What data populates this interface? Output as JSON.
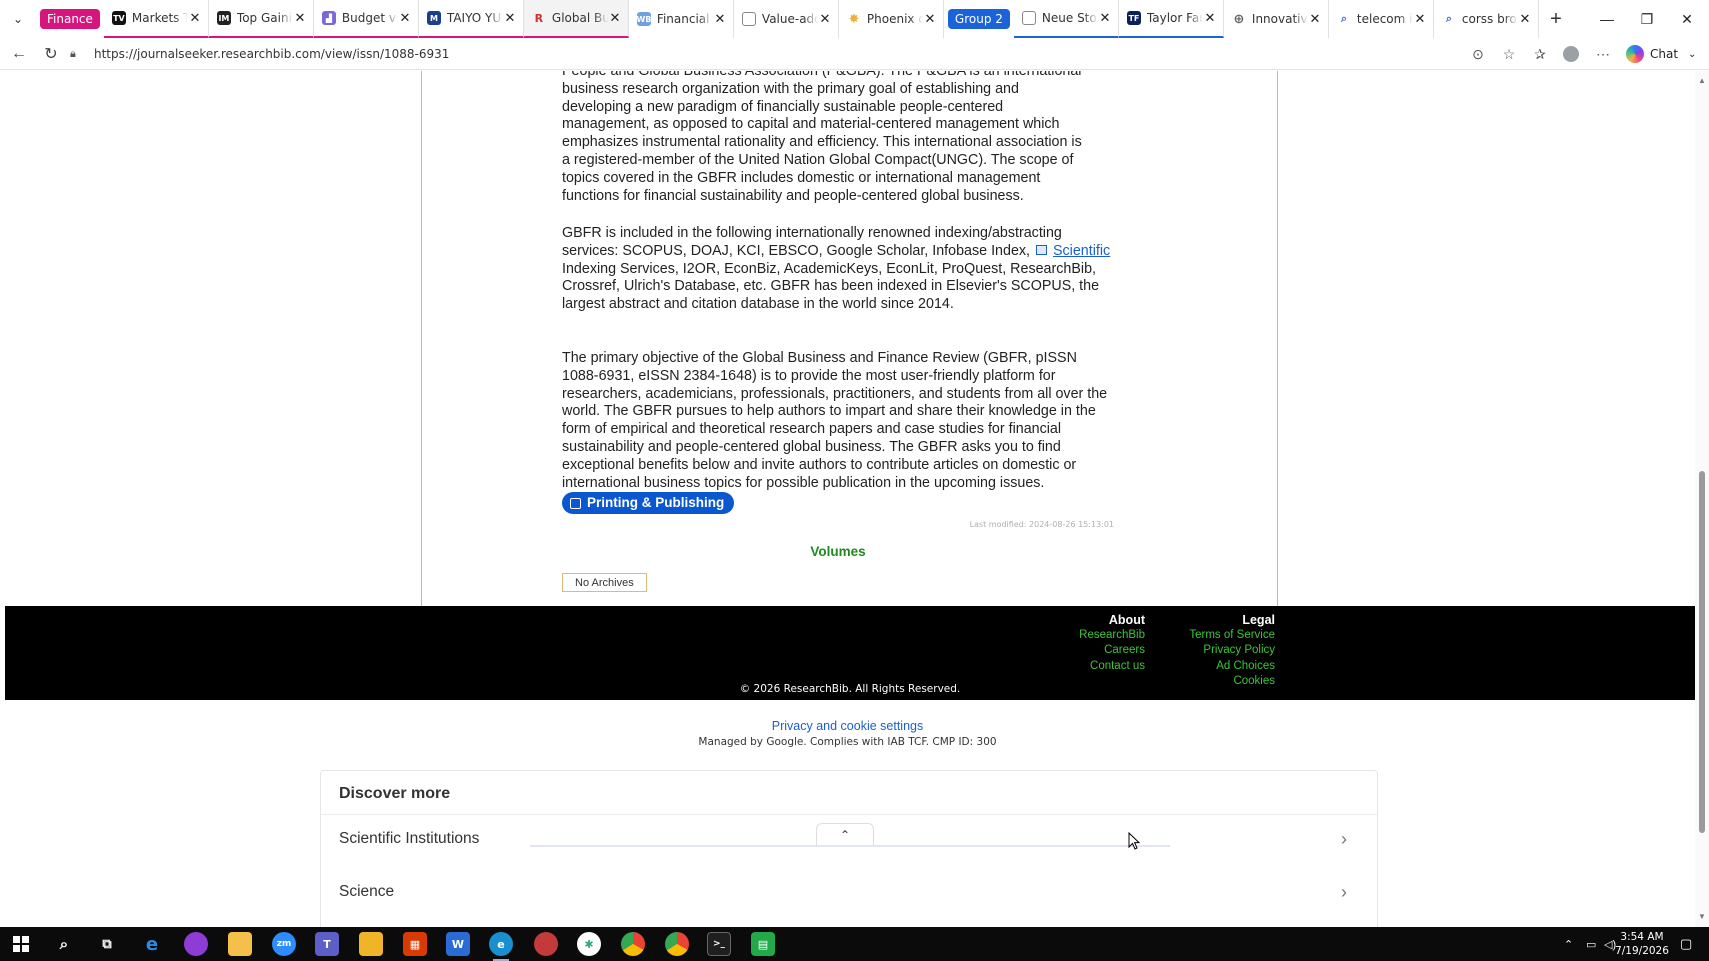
{
  "browser": {
    "tab_groups": [
      {
        "label": "Finance",
        "color": "#d6157e"
      },
      {
        "label": "Group 2",
        "color": "#1a63d8"
      }
    ],
    "tabs": [
      {
        "title": "Markets Today",
        "favicon": "TV",
        "favicon_color": "#111111",
        "group": "finance"
      },
      {
        "title": "Top Gaining",
        "favicon": "IM",
        "favicon_color": "#222222",
        "group": "finance"
      },
      {
        "title": "Budget vs. I",
        "favicon": "chart",
        "favicon_color": "#7a6ad6",
        "group": "finance"
      },
      {
        "title": "TAIYO YUDEN",
        "favicon": "M",
        "favicon_color": "#1b3f8c",
        "group": "finance"
      },
      {
        "title": "Global Busin",
        "favicon": "R",
        "favicon_color": "#d0302f",
        "group": "finance",
        "active": true
      },
      {
        "title": "Financial Re",
        "favicon": "WB",
        "favicon_color": "#6fa1e0",
        "group": "none"
      },
      {
        "title": "Value-added",
        "favicon": "doc",
        "favicon_color": "#666666",
        "group": "none"
      },
      {
        "title": "Phoenix de",
        "favicon": "sun",
        "favicon_color": "#e8b23b",
        "group": "none"
      },
      {
        "title": "Neue Story",
        "favicon": "doc",
        "favicon_color": "#666666",
        "group": "group2"
      },
      {
        "title": "Taylor Farm",
        "favicon": "TF",
        "favicon_color": "#0b1f5a",
        "group": "group2"
      },
      {
        "title": "Innovative F",
        "favicon": "globe",
        "favicon_color": "#666666",
        "group": "none"
      },
      {
        "title": "telecom ital",
        "favicon": "search",
        "favicon_color": "#4b6ad6",
        "group": "none"
      },
      {
        "title": "corss brows",
        "favicon": "search",
        "favicon_color": "#4b6ad6",
        "group": "none"
      }
    ],
    "url": "https://journalseeker.researchbib.com/view/issn/1088-6931",
    "chat_label": "Chat"
  },
  "page": {
    "para1_lines": [
      "People and Global Business Association (P&GBA). The P&GBA is an international",
      "business research organization with the primary goal of establishing and",
      "developing a new paradigm of financially sustainable people-centered",
      "management, as opposed to capital and material-centered management which",
      "emphasizes instrumental rationality and efficiency. This international association is",
      "a registered-member of the United Nation Global Compact(UNGC). The scope of",
      "topics covered in the GBFR includes domestic or international management",
      "functions for financial sustainability and people-centered global business."
    ],
    "para2": {
      "before_link": "GBFR is included in the following internationally renowned indexing/abstracting services: SCOPUS, DOAJ, KCI, EBSCO, Google Scholar, Infobase Index,",
      "link": "Scientific",
      "after_link": "Indexing Services, I2OR, EconBiz, AcademicKeys, EconLit, ProQuest, ResearchBib, Crossref, Ulrich's Database, etc. GBFR has been indexed in Elsevier's SCOPUS, the largest abstract and citation database in the world since 2014."
    },
    "para3": "The primary objective of the Global Business and Finance Review (GBFR, pISSN 1088-6931, eISSN 2384-1648) is to provide the most user-friendly platform for researchers, academicians, professionals, practitioners, and students from all over the world. The GBFR pursues to help authors to impart and share their knowledge in the form of empirical and theoretical research papers and case studies for financial sustainability and people-centered global business. The GBFR asks you to find exceptional benefits below and invite authors to contribute articles on domestic or international business topics for possible publication in the upcoming issues.",
    "pill_label": "Printing & Publishing",
    "last_modified": "Last modified: 2024-08-26 15:13:01",
    "volumes_label": "Volumes",
    "no_archives_label": "No Archives"
  },
  "footer": {
    "about_heading": "About",
    "about_links": [
      "ResearchBib",
      "Careers",
      "Contact us"
    ],
    "legal_heading": "Legal",
    "legal_links": [
      "Terms of Service",
      "Privacy Policy",
      "Ad Choices",
      "Cookies"
    ],
    "copyright": "© 2026 ResearchBib. All Rights Reserved."
  },
  "cookie": {
    "link": "Privacy and cookie settings",
    "note": "Managed by Google. Complies with IAB TCF. CMP ID: 300"
  },
  "discover": {
    "heading": "Discover more",
    "items": [
      "Scientific Institutions",
      "Science"
    ]
  },
  "taskbar": {
    "time": "3:54 AM",
    "date": "7/19/2026"
  }
}
